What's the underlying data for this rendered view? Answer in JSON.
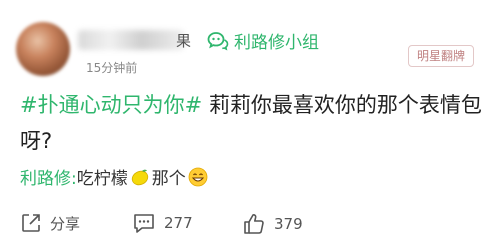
{
  "post": {
    "author_partial": "果",
    "time": "15分钟前",
    "group": {
      "label": "利路修小组",
      "icon": "wechat-icon"
    },
    "badge": "明星翻牌",
    "topic": "#扑通心动只为你#",
    "text": " 莉莉你最喜欢你的那个表情包呀?",
    "comment": {
      "author": "利路修:",
      "text_before": " 吃柠檬",
      "lemon_icon": "lemon-emoji",
      "text_after": "那个",
      "smile_icon": "grin-emoji"
    }
  },
  "actions": {
    "share": {
      "label": "分享",
      "icon": "share-icon"
    },
    "comments": {
      "count": "277",
      "icon": "comment-icon"
    },
    "likes": {
      "count": "379",
      "icon": "thumbs-up-icon"
    }
  },
  "colors": {
    "accent": "#2fb66d",
    "badge": "#c08282"
  }
}
